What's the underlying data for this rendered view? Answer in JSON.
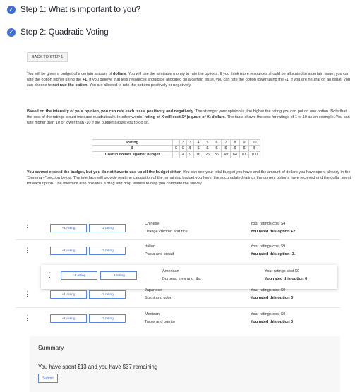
{
  "steps": [
    {
      "label": "Step 1: What is important to you?"
    },
    {
      "label": "Step 2: Quadratic Voting"
    }
  ],
  "back_button": "BACK TO STEP 1",
  "paragraphs": {
    "p1": [
      {
        "t": "You will be given a budget of a certain amount of "
      },
      {
        "t": "dollars",
        "b": true
      },
      {
        "t": ". You will use the available money to rate the options. If you think more resources should be allocated to a certain issue, you can rate the option higher using the "
      },
      {
        "t": "+1",
        "b": true
      },
      {
        "t": ". If you believe that less resources should be allocated on a certain issue, you can rate the option lower using the "
      },
      {
        "t": "-1",
        "b": true
      },
      {
        "t": ". If you are neutral on an issue, you can choose to "
      },
      {
        "t": "not rate the option",
        "b": true
      },
      {
        "t": ". You are allowed to rate the options positively or negatively."
      }
    ],
    "p2": [
      {
        "t": "Based on the intensity of your opinion, you can rate each issue positively and negatively",
        "b": true
      },
      {
        "t": ". The stronger your opinion is, the higher the rating you can put on one option. Note that the cost of the ratings would increase quadratically. In other words, "
      },
      {
        "t": "rating of X will cost X² (square of X) dollars",
        "b": true
      },
      {
        "t": ". The table shows the cost for ratings of 1 to 10 as an example. You can rate higher than 10 or lower than -10 if the budget allows you to do so."
      }
    ],
    "p3": [
      {
        "t": "You cannot exceed the budget, but you do not have to use up all the budget either",
        "b": true
      },
      {
        "t": ". You can see your total budget you have and the amount of dollars you have spent already in the “Summary” section below. The interface will provide realtime calculation of the remaining budget you have, the accumulated ratings the current options have recieved and the dollar spent for each option. The interface also provides a drag and drop feature to help you complete the survey."
      }
    ]
  },
  "cost_table": {
    "rating_label": "Rating",
    "dollar_label": "$",
    "cost_label": "Cost in dollars against budget",
    "ratings": [
      "1",
      "2",
      "3",
      "4",
      "5",
      "6",
      "7",
      "8",
      "9",
      "10"
    ],
    "dollar_icons": [
      "$",
      "$",
      "$",
      "$",
      "$",
      "$",
      "$",
      "$",
      "$",
      "$"
    ],
    "costs": [
      "1",
      "4",
      "9",
      "16",
      "25",
      "36",
      "49",
      "64",
      "81",
      "100"
    ]
  },
  "plus_label": "+1 rating",
  "minus_label": "-1 rating",
  "drag_icon": "⋮",
  "options": [
    {
      "name": "Chinese",
      "desc": "Orange chicken and rice",
      "cost": "Your ratings cost $4",
      "rated": "You rated this option +2"
    },
    {
      "name": "Italian",
      "desc": "Pasta and bread",
      "cost": "Your ratings cost $9",
      "rated": "You rated this option -3."
    },
    {
      "name": "American",
      "desc": "Burgers, fries and ribs",
      "cost": "Your ratings cost $0",
      "rated": "You rated this option 0"
    },
    {
      "name": "Japanese",
      "desc": "Sushi and udon",
      "cost": "Your ratings cost $0",
      "rated": "You rated this option 0"
    },
    {
      "name": "Mexican",
      "desc": "Tacos and burrito",
      "cost": "Your ratings cost $0",
      "rated": "You rated this option 0"
    }
  ],
  "summary": {
    "title": "Summary",
    "spent": "You have spent $13 and you have $37 remaining",
    "submit": "Submit"
  },
  "colors": {
    "accent": "#3f6fd6"
  }
}
